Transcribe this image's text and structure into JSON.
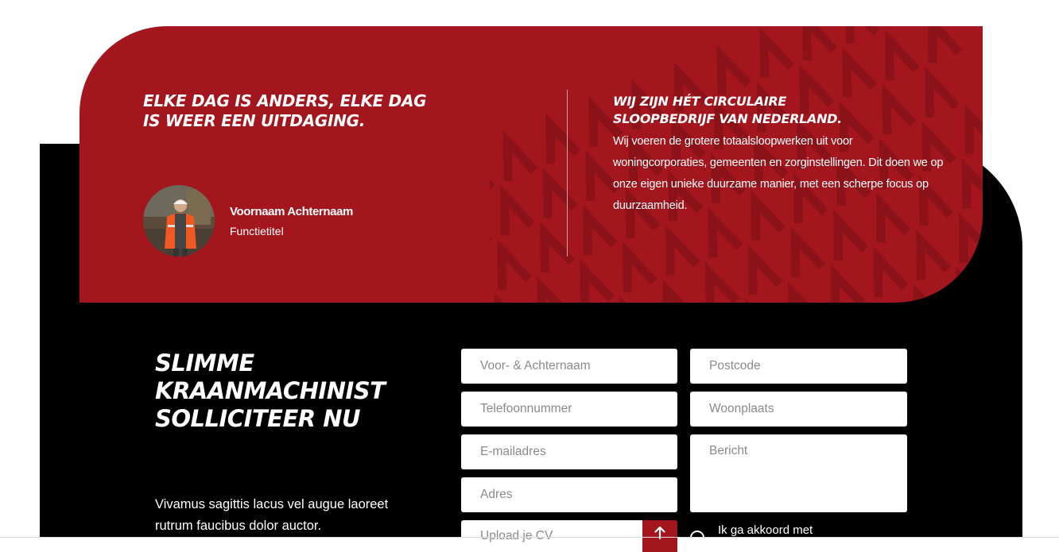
{
  "testimonial": {
    "quote": "ELKE DAG IS ANDERS, ELKE DAG IS WEER EEN UITDAGING.",
    "person_name": "Voornaam Achternaam",
    "person_role": "Functietitel"
  },
  "about": {
    "heading": "WIJ ZIJN HÉT CIRCULAIRE SLOOPBEDRIJF VAN NEDERLAND.",
    "text": "Wij voeren de grotere totaalsloopwerken uit voor woningcorporaties, gemeenten en zorginstellingen. Dit doen we op onze eigen unieke duurzame manier, met een scherpe focus op duurzaamheid."
  },
  "form": {
    "title": "SLIMME KRAANMACHINIST SOLLICITEER NU",
    "intro": "Vivamus sagittis lacus vel augue laoreet rutrum faucibus dolor auctor.",
    "placeholders": {
      "name": "Voor- & Achternaam",
      "phone": "Telefoonnummer",
      "email": "E-mailadres",
      "address": "Adres",
      "upload": "Upload je CV",
      "postcode": "Postcode",
      "city": "Woonplaats",
      "message": "Bericht"
    },
    "consent": "Ik ga akkoord met"
  },
  "colors": {
    "brand_red": "#a3161d",
    "background_dark": "#000000"
  },
  "icons": {
    "upload": "arrow-up-icon",
    "pattern": "a-letter-pattern"
  }
}
